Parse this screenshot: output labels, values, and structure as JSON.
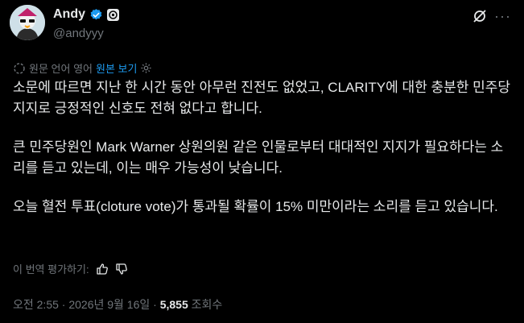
{
  "author": {
    "name": "Andy",
    "handle": "@andyyy"
  },
  "translation": {
    "source_note": "원문 언어 영어",
    "show_original": "원본 보기"
  },
  "post": {
    "paragraphs": [
      "소문에 따르면 지난 한 시간 동안 아무런 진전도 없었고, CLARITY에 대한 충분한 민주당 지지로 긍정적인 신호도 전혀 없다고 합니다.",
      "큰 민주당원인 Mark Warner 상원의원 같은 인물로부터 대대적인 지지가 필요하다는 소리를 듣고 있는데, 이는 매우 가능성이 낮습니다.",
      "오늘 혈전 투표(cloture vote)가 통과될 확률이 15% 미만이라는 소리를 듣고 있습니다."
    ]
  },
  "rating": {
    "label": "이 번역 평가하기:"
  },
  "meta": {
    "time_date": "오전 2:55 · 2026년 9월 16일 · ",
    "views_count": "5,855",
    "views_label": " 조회수"
  },
  "icons": {
    "verified": "verified-badge-icon",
    "affiliate": "affiliate-badge-icon",
    "grok": "grok-icon",
    "more": "more-icon",
    "translate": "translate-icon",
    "settings": "settings-gear-icon",
    "thumbs_up": "thumbs-up-icon",
    "thumbs_down": "thumbs-down-icon"
  },
  "colors": {
    "background": "#000000",
    "text": "#e7e9ea",
    "muted": "#71767b",
    "accent": "#1d9bf0"
  }
}
